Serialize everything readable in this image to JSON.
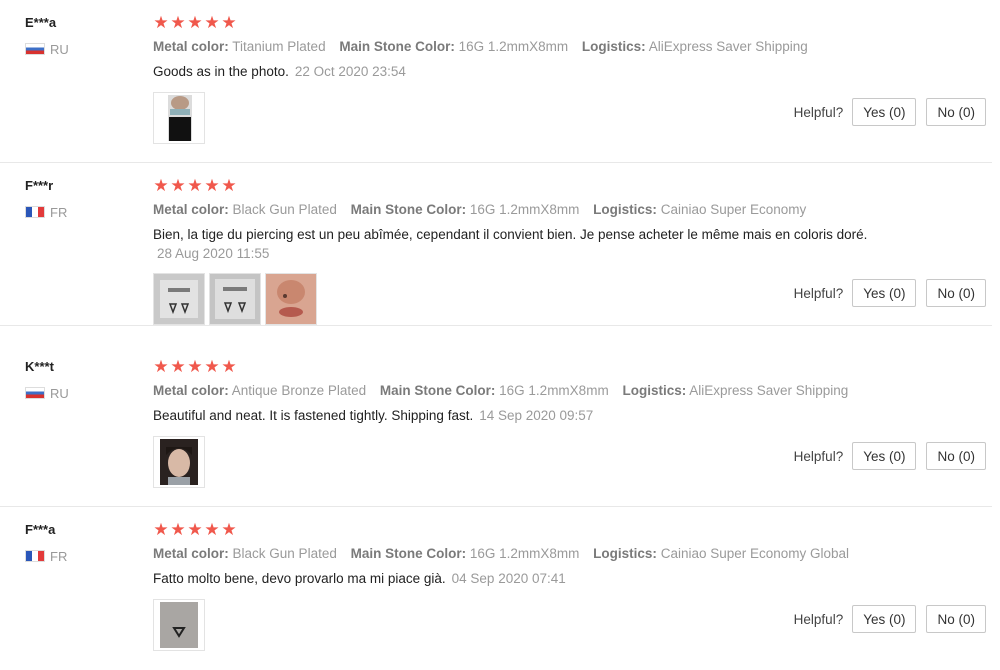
{
  "reviews": [
    {
      "user": "E***a",
      "country": "RU",
      "stars": [
        "★",
        "★",
        "★",
        "★",
        "★"
      ],
      "attrs": [
        {
          "label": "Metal color:",
          "value": "Titanium Plated"
        },
        {
          "label": "Main Stone Color:",
          "value": "16G 1.2mmX8mm"
        },
        {
          "label": "Logistics:",
          "value": "AliExpress Saver Shipping"
        }
      ],
      "text": "Goods as in the photo.",
      "date": "22 Oct 2020 23:54",
      "helpful_label": "Helpful?",
      "yes_label": "Yes (0)",
      "no_label": "No (0)"
    },
    {
      "user": "F***r",
      "country": "FR",
      "stars": [
        "★",
        "★",
        "★",
        "★",
        "★"
      ],
      "attrs": [
        {
          "label": "Metal color:",
          "value": "Black Gun Plated"
        },
        {
          "label": "Main Stone Color:",
          "value": "16G 1.2mmX8mm"
        },
        {
          "label": "Logistics:",
          "value": "Cainiao Super Economy"
        }
      ],
      "text": "Bien, la tige du piercing est un peu abîmée, cependant il convient bien. Je pense acheter le même mais en coloris doré.",
      "date": "28 Aug 2020 11:55",
      "helpful_label": "Helpful?",
      "yes_label": "Yes (0)",
      "no_label": "No (0)"
    },
    {
      "user": "K***t",
      "country": "RU",
      "stars": [
        "★",
        "★",
        "★",
        "★",
        "★"
      ],
      "attrs": [
        {
          "label": "Metal color:",
          "value": "Antique Bronze Plated"
        },
        {
          "label": "Main Stone Color:",
          "value": "16G 1.2mmX8mm"
        },
        {
          "label": "Logistics:",
          "value": "AliExpress Saver Shipping"
        }
      ],
      "text": "Beautiful and neat. It is fastened tightly. Shipping fast.",
      "date": "14 Sep 2020 09:57",
      "helpful_label": "Helpful?",
      "yes_label": "Yes (0)",
      "no_label": "No (0)"
    },
    {
      "user": "F***a",
      "country": "FR",
      "stars": [
        "★",
        "★",
        "★",
        "★",
        "★"
      ],
      "attrs": [
        {
          "label": "Metal color:",
          "value": "Black Gun Plated"
        },
        {
          "label": "Main Stone Color:",
          "value": "16G 1.2mmX8mm"
        },
        {
          "label": "Logistics:",
          "value": "Cainiao Super Economy Global"
        }
      ],
      "text": "Fatto molto bene, devo provarlo ma mi piace già.",
      "date": "04 Sep 2020 07:41",
      "helpful_label": "Helpful?",
      "yes_label": "Yes (0)",
      "no_label": "No (0)"
    }
  ],
  "colors": {
    "star": "#f0584c",
    "attr_label": "#7a7a7a",
    "muted": "#9a9a9a",
    "divider": "#e8e8e8"
  }
}
